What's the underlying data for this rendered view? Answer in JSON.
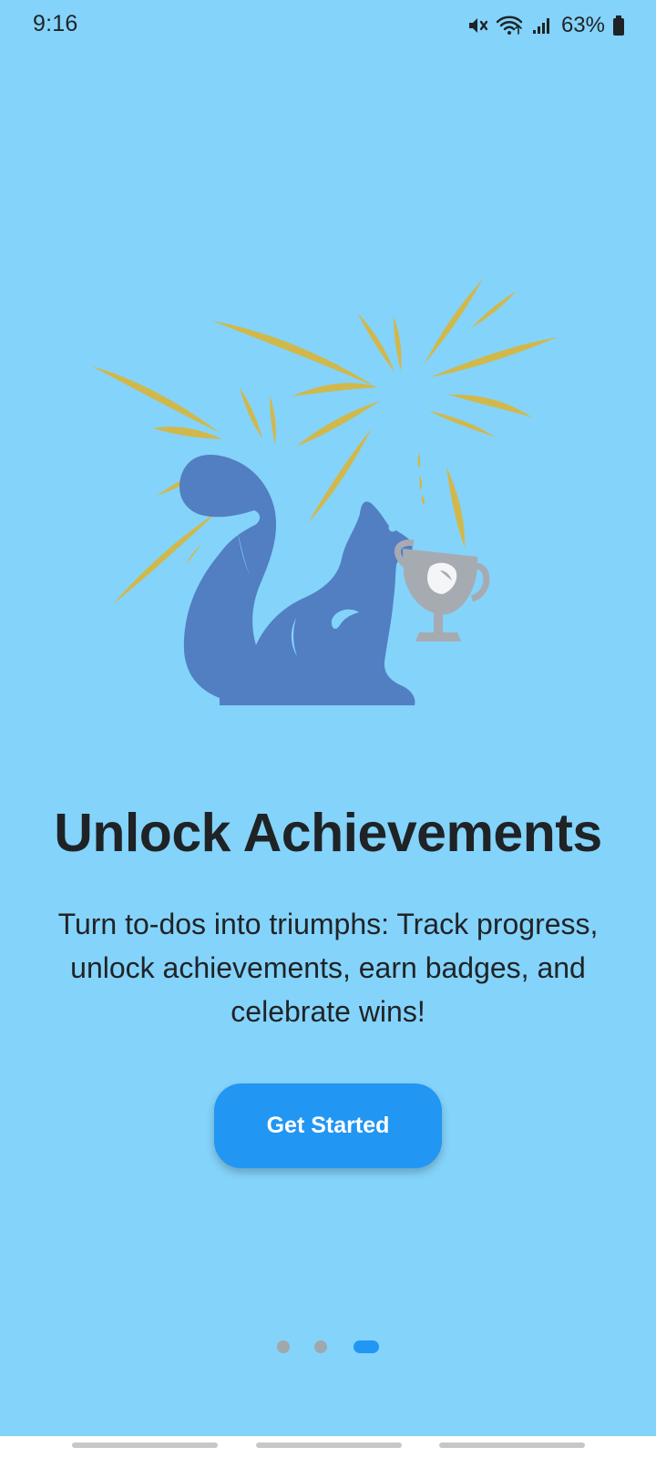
{
  "status_bar": {
    "time": "9:16",
    "battery": "63%",
    "icons": [
      "mute-icon",
      "wifi-icon",
      "signal-icon",
      "battery-icon"
    ]
  },
  "hero": {
    "icon": "squirrel-trophy-illustration",
    "colors": {
      "squirrel": "#527ec2",
      "sparks": "#d1b84b",
      "trophy": "#a6abb2",
      "acorn": "#f4f5f7"
    }
  },
  "onboarding": {
    "title": "Unlock Achievements",
    "description": "Turn to-dos into triumphs: Track progress, unlock achievements, earn badges, and celebrate wins!",
    "primary_action": "Get Started"
  },
  "pager": {
    "total_pages": 3,
    "current_page": 3
  },
  "theme": {
    "background": "#84d3fa",
    "accent": "#2196f3",
    "text": "#1f2326"
  }
}
